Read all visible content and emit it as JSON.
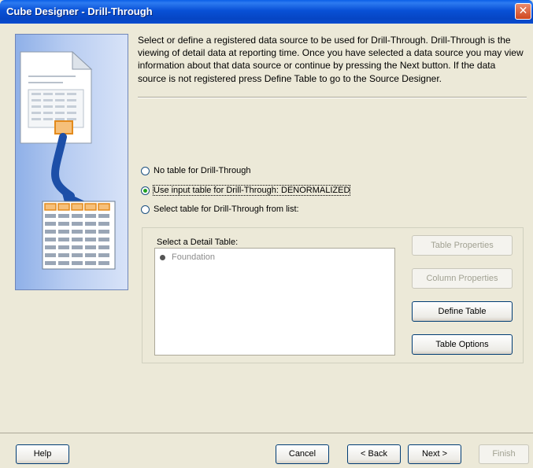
{
  "window": {
    "title": "Cube Designer - Drill-Through",
    "close_glyph": "✕"
  },
  "description": "Select or define a registered data source to be used for Drill-Through. Drill-Through is the viewing of detail data at reporting time. Once you have selected a data source you may view information about that data source or continue by pressing the Next button. If the data source is not registered press Define Table to go to the Source Designer.",
  "options": {
    "no_table": "No table for Drill-Through",
    "use_input": "Use input table for Drill-Through: DENORMALIZED",
    "select_list": "Select table for Drill-Through from list:",
    "selected": "use_input"
  },
  "detail_group": {
    "label": "Select a Detail Table:",
    "items": [
      "Foundation"
    ]
  },
  "side_buttons": {
    "table_properties": "Table Properties",
    "column_properties": "Column Properties",
    "define_table": "Define Table",
    "table_options": "Table Options"
  },
  "footer": {
    "help": "Help",
    "cancel": "Cancel",
    "back": "< Back",
    "next": "Next >",
    "finish": "Finish"
  },
  "colors": {
    "titlebar": "#0a4cd0",
    "dialog_bg": "#ece9d8",
    "radio_selected": "#21a121",
    "disabled_text": "#a1a192"
  }
}
